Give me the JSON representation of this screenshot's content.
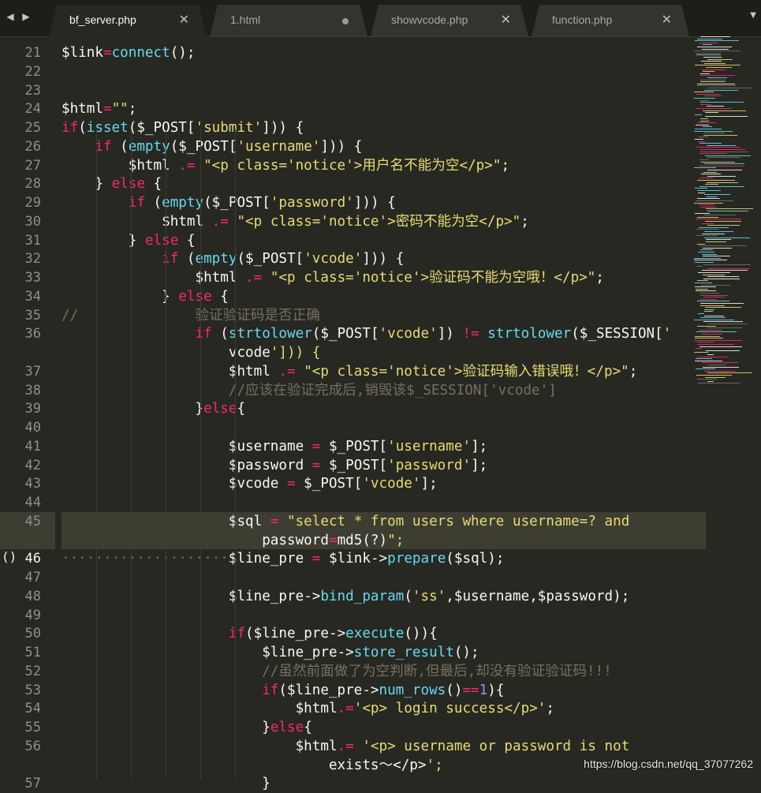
{
  "tabs": [
    {
      "label": "bf_server.php",
      "active": true,
      "modified": false
    },
    {
      "label": "1.html",
      "active": false,
      "modified": true
    },
    {
      "label": "showvcode.php",
      "active": false,
      "modified": false
    },
    {
      "label": "function.php",
      "active": false,
      "modified": false
    }
  ],
  "nav": {
    "left_icon": "chevron-left-icon",
    "right_icon": "chevron-right-icon",
    "overflow_icon": "chevron-down-icon"
  },
  "editor": {
    "current_line": "46",
    "lines": [
      {
        "num": "21",
        "text": "$link=connect();"
      },
      {
        "num": "22",
        "text": ""
      },
      {
        "num": "23",
        "text": ""
      },
      {
        "num": "24",
        "text": "$html=\"\";"
      },
      {
        "num": "25",
        "text": "if(isset($_POST['submit'])) {"
      },
      {
        "num": "26",
        "text": "    if (empty($_POST['username'])) {"
      },
      {
        "num": "27",
        "text": "        $html .= \"<p class='notice'>用户名不能为空</p>\";"
      },
      {
        "num": "28",
        "text": "    } else {"
      },
      {
        "num": "29",
        "text": "        if (empty($_POST['password'])) {"
      },
      {
        "num": "30",
        "text": "            $html .= \"<p class='notice'>密码不能为空</p>\";"
      },
      {
        "num": "31",
        "text": "        } else {"
      },
      {
        "num": "32",
        "text": "            if (empty($_POST['vcode'])) {"
      },
      {
        "num": "33",
        "text": "                $html .= \"<p class='notice'>验证码不能为空哦！</p>\";"
      },
      {
        "num": "34",
        "text": "            } else {"
      },
      {
        "num": "35",
        "text": "//              验证验证码是否正确"
      },
      {
        "num": "36",
        "text": "                if (strtolower($_POST['vcode']) != strtolower($_SESSION['"
      },
      {
        "num": "",
        "text": "                    vcode'])) {"
      },
      {
        "num": "37",
        "text": "                    $html .= \"<p class='notice'>验证码输入错误哦！</p>\";"
      },
      {
        "num": "38",
        "text": "                    //应该在验证完成后,销毁该$_SESSION['vcode']"
      },
      {
        "num": "39",
        "text": "                }else{"
      },
      {
        "num": "40",
        "text": ""
      },
      {
        "num": "41",
        "text": "                    $username = $_POST['username'];"
      },
      {
        "num": "42",
        "text": "                    $password = $_POST['password'];"
      },
      {
        "num": "43",
        "text": "                    $vcode = $_POST['vcode'];"
      },
      {
        "num": "44",
        "text": ""
      },
      {
        "num": "45",
        "text": "                    $sql = \"select * from users where username=? and "
      },
      {
        "num": "",
        "text": "                        password=md5(?)\";"
      },
      {
        "num": "46",
        "text": "                    $line_pre = $link->prepare($sql);"
      },
      {
        "num": "47",
        "text": ""
      },
      {
        "num": "48",
        "text": "                    $line_pre->bind_param('ss',$username,$password);"
      },
      {
        "num": "49",
        "text": ""
      },
      {
        "num": "50",
        "text": "                    if($line_pre->execute()){"
      },
      {
        "num": "51",
        "text": "                        $line_pre->store_result();"
      },
      {
        "num": "52",
        "text": "                        //虽然前面做了为空判断,但最后,却没有验证验证码!!!"
      },
      {
        "num": "53",
        "text": "                        if($line_pre->num_rows()==1){"
      },
      {
        "num": "54",
        "text": "                            $html.='<p> login success</p>';"
      },
      {
        "num": "55",
        "text": "                        }else{"
      },
      {
        "num": "56",
        "text": "                            $html.= '<p> username or password is not "
      },
      {
        "num": "",
        "text": "                                exists～</p>';"
      },
      {
        "num": "57",
        "text": "                        }"
      }
    ]
  },
  "gutter_marker": "()",
  "watermark": "https://blog.csdn.net/qq_37077262",
  "colors": {
    "background": "#272822",
    "keyword": "#f92672",
    "function": "#66d9ef",
    "string": "#e6db74",
    "number": "#ae81ff",
    "comment": "#75715e",
    "text": "#f8f8f2"
  }
}
